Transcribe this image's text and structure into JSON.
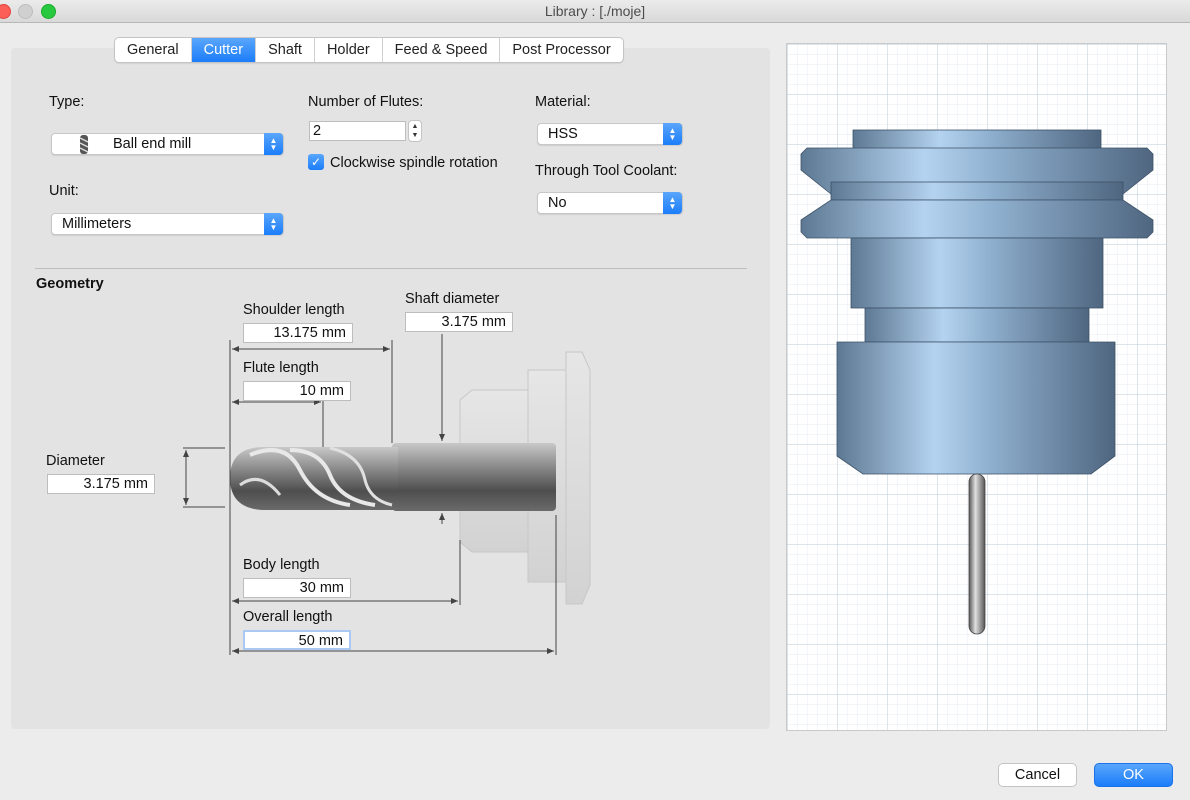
{
  "window": {
    "title": "Library : [./moje]"
  },
  "tabs": [
    {
      "label": "General",
      "selected": false
    },
    {
      "label": "Cutter",
      "selected": true
    },
    {
      "label": "Shaft",
      "selected": false
    },
    {
      "label": "Holder",
      "selected": false
    },
    {
      "label": "Feed & Speed",
      "selected": false
    },
    {
      "label": "Post Processor",
      "selected": false
    }
  ],
  "form": {
    "type_label": "Type:",
    "type_value": "Ball end mill",
    "unit_label": "Unit:",
    "unit_value": "Millimeters",
    "flutes_label": "Number of Flutes:",
    "flutes_value": "2",
    "clockwise_label": "Clockwise spindle rotation",
    "clockwise_checked": true,
    "material_label": "Material:",
    "material_value": "HSS",
    "coolant_label": "Through Tool Coolant:",
    "coolant_value": "No"
  },
  "geometry": {
    "title": "Geometry",
    "shoulder_length_label": "Shoulder length",
    "shoulder_length_value": "13.175 mm",
    "shaft_diameter_label": "Shaft diameter",
    "shaft_diameter_value": "3.175 mm",
    "flute_length_label": "Flute length",
    "flute_length_value": "10 mm",
    "diameter_label": "Diameter",
    "diameter_value": "3.175 mm",
    "body_length_label": "Body length",
    "body_length_value": "30 mm",
    "overall_length_label": "Overall length",
    "overall_length_value": "50 mm"
  },
  "buttons": {
    "cancel": "Cancel",
    "ok": "OK"
  },
  "colors": {
    "accent": "#1b7dfa",
    "holder_blue": "#7d9fc0",
    "tool_gray": "#6f6f6f"
  }
}
